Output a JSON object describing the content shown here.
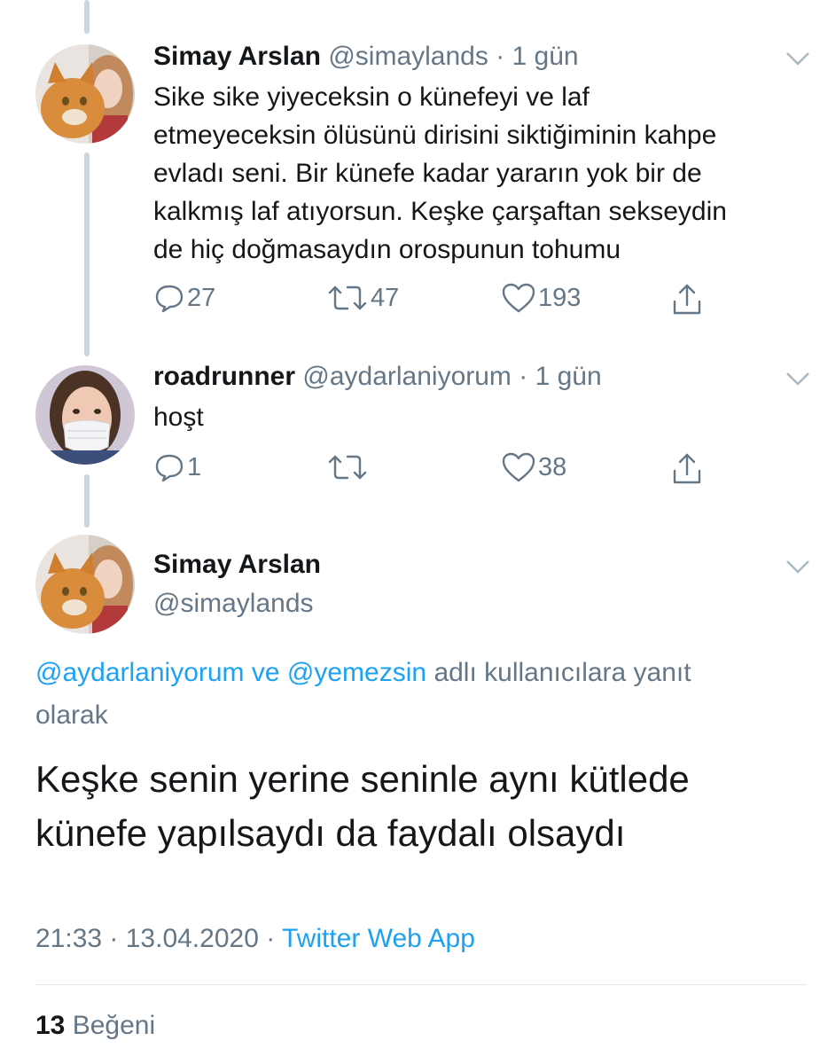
{
  "tweets": [
    {
      "name": "Simay Arslan",
      "handle": "@simaylands",
      "time": "· 1 gün",
      "lines": [
        "Sike sike yiyeceksin o künefeyi ve laf",
        "etmeyeceksin ölüsünü dirisini siktiğiminin kahpe",
        "evladı seni. Bir künefe kadar yararın yok bir de",
        "kalkmış laf atıyorsun. Keşke çarşaftan sekseydin",
        "de hiç doğmasaydın orospunun tohumu"
      ],
      "replies": "27",
      "retweets": "47",
      "likes": "193",
      "avatar": "woman-with-orange-cat"
    },
    {
      "name": "roadrunner",
      "handle": "@aydarlaniyorum",
      "time": "· 1 gün",
      "lines": [
        "hoşt"
      ],
      "replies": "1",
      "retweets": "",
      "likes": "38",
      "avatar": "woman-with-face-mask"
    }
  ],
  "main_tweet": {
    "name": "Simay Arslan",
    "handle": "@simaylands",
    "reply_mention_1": "@aydarlaniyorum",
    "reply_and": "ve",
    "reply_mention_2": "@yemezsin",
    "reply_suffix": "adlı kullanıcılara yanıt",
    "reply_suffix_2": "olarak",
    "text_line_1": "Keşke senin yerine seninle aynı kütlede",
    "text_line_2": "künefe yapılsaydı da faydalı olsaydı",
    "time": "21:33 · 13.04.2020 ·",
    "source": "Twitter Web App",
    "like_count": "13",
    "like_label": "Beğeni"
  },
  "colors": {
    "accent": "#1da1f2",
    "secondary_text": "#657786",
    "primary_text": "#14171a",
    "thread_line": "#ccd6dd"
  },
  "icons": [
    "reply-icon",
    "retweet-icon",
    "like-icon",
    "share-icon",
    "chevron-down-icon"
  ]
}
